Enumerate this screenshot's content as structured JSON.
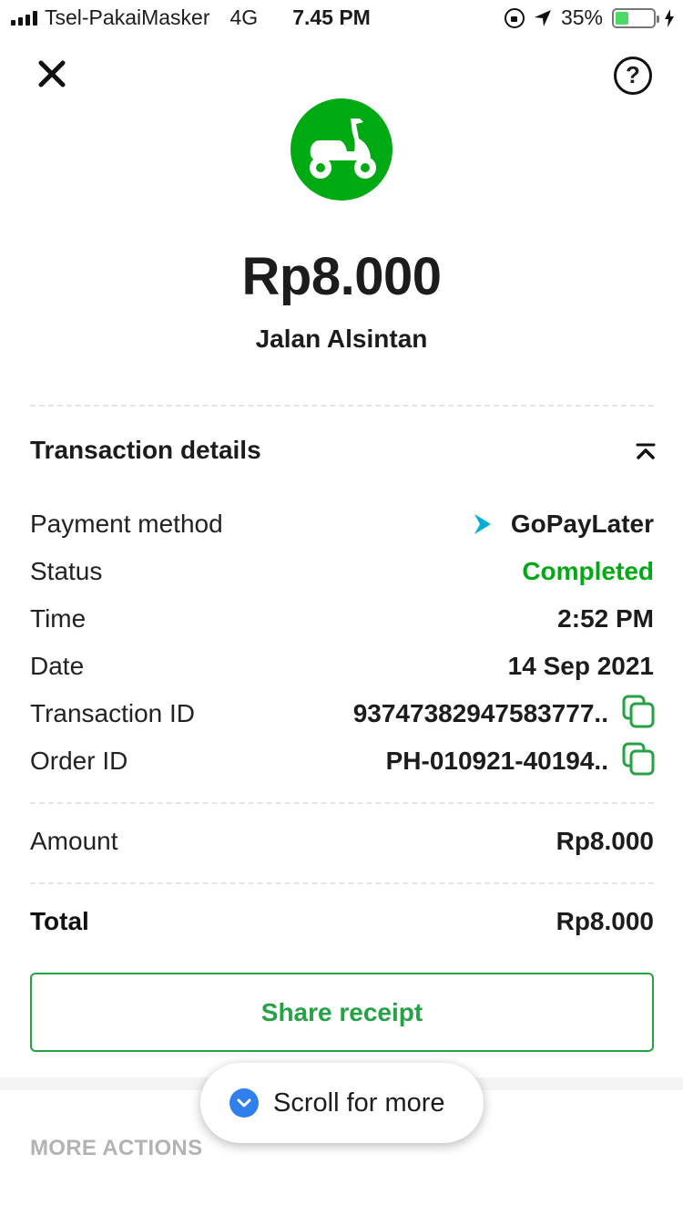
{
  "status_bar": {
    "carrier": "Tsel-PakaiMasker",
    "network": "4G",
    "time": "7.45 PM",
    "battery_percent": "35%",
    "battery_level": 0.35
  },
  "header": {
    "help_label": "?",
    "amount": "Rp8.000",
    "merchant": "Jalan Alsintan",
    "service_icon": "scooter-icon",
    "service_color": "#00aa13"
  },
  "transaction_details": {
    "title": "Transaction details",
    "rows": [
      {
        "label": "Payment method",
        "value": "GoPayLater"
      },
      {
        "label": "Status",
        "value": "Completed"
      },
      {
        "label": "Time",
        "value": "2:52 PM"
      },
      {
        "label": "Date",
        "value": "14 Sep 2021"
      },
      {
        "label": "Transaction ID",
        "value": "93747382947583777.."
      },
      {
        "label": "Order ID",
        "value": "PH-010921-40194.."
      }
    ]
  },
  "summary": {
    "amount_label": "Amount",
    "amount_value": "Rp8.000",
    "total_label": "Total",
    "total_value": "Rp8.000"
  },
  "actions": {
    "share_label": "Share receipt",
    "more_actions_label": "MORE ACTIONS",
    "scroll_hint": "Scroll for more"
  },
  "colors": {
    "accent_green": "#00aa13",
    "button_green": "#25a244",
    "scroll_blue": "#2f80ed"
  }
}
